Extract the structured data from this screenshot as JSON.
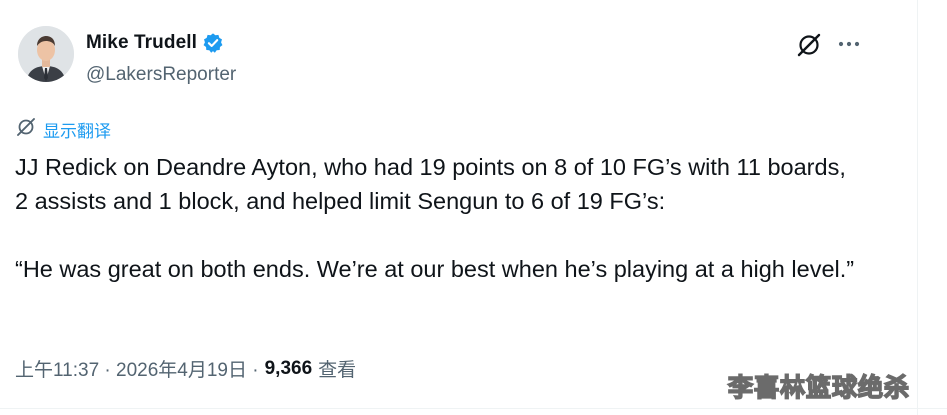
{
  "author": {
    "display_name": "Mike Trudell",
    "handle": "@LakersReporter"
  },
  "translate": {
    "label": "显示翻译"
  },
  "tweet": {
    "text": "JJ Redick on Deandre Ayton, who had 19 points on 8 of 10 FG’s with 11 boards, 2 assists and 1 block, and helped limit Sengun to 6 of 19 FG’s:\n\n“He was great on both ends. We’re at our best when he’s playing at a high level.”"
  },
  "meta": {
    "timestamp": "上午11:37 · 2026年4月19日 ·",
    "views_count": "9,366",
    "views_label": "查看"
  },
  "watermark": {
    "text": "李喜林篮球绝杀"
  },
  "colors": {
    "accent": "#1d9bf0",
    "text_primary": "#0f1419",
    "text_secondary": "#536471"
  },
  "icons": {
    "verified": "verified-badge-icon",
    "grok": "grok-icon",
    "more": "more-icon",
    "translate": "translate-icon"
  }
}
